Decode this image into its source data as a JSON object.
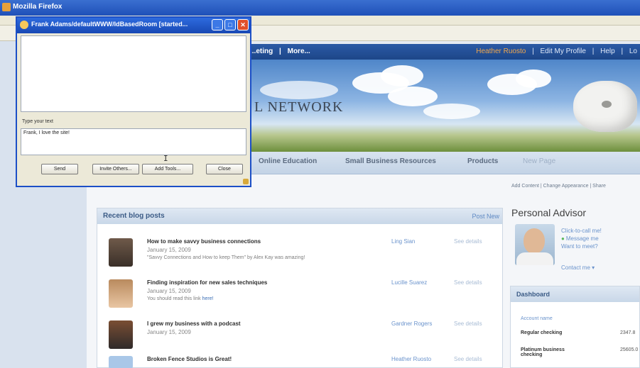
{
  "browser": {
    "title": "Mozilla Firefox"
  },
  "site": {
    "topnav_left": [
      "...eting",
      "|",
      "More..."
    ],
    "topnav_right": [
      "Heather Ruosto",
      "|",
      "Edit My Profile",
      "|",
      "Help",
      "|",
      "Lo"
    ],
    "hero_title": "L NETWORK",
    "tabs": [
      "Online Education",
      "Small Business Resources",
      "Products",
      "New Page"
    ],
    "util_links": "Add Content  |  Change Appearance  |  Share"
  },
  "blog": {
    "title": "Recent blog posts",
    "post_new": "Post New",
    "posts": [
      {
        "title": "How to make savvy business connections",
        "date": "January 15, 2009",
        "excerpt": "\"Savvy Connections and How to keep Them\" by Alex Kay was amazing!",
        "excerpt_link": "",
        "author": "Ling Sian",
        "details": "See details"
      },
      {
        "title": "Finding inspiration for new sales techniques",
        "date": "January 15, 2009",
        "excerpt": "You should read this link",
        "excerpt_link": "here!",
        "author": "Lucille Suarez",
        "details": "See details"
      },
      {
        "title": "I grew my business with a podcast",
        "date": "January 15, 2009",
        "excerpt": "",
        "excerpt_link": "",
        "author": "Gardner Rogers",
        "details": "See details"
      },
      {
        "title": "Broken Fence Studios is Great!",
        "date": "",
        "excerpt": "",
        "excerpt_link": "",
        "author": "Heather Ruosto",
        "details": "See details"
      }
    ]
  },
  "advisor": {
    "title": "Personal Advisor",
    "links": [
      "Click-to-call me!",
      "Message me",
      "Want to meet?"
    ],
    "contact": "Contact me"
  },
  "dashboard": {
    "title": "Dashboard",
    "header_col": "Account name",
    "rows": [
      {
        "name": "Regular checking",
        "value": "2347.8"
      },
      {
        "name": "Platinum business checking",
        "value": "25605.0"
      }
    ]
  },
  "chat": {
    "title": "Frank Adams/defaultWWW/IdBasedRoom [started...",
    "label": "Type your text",
    "input_value": "Frank, I love the site!",
    "buttons": [
      "Send",
      "Invite Others...",
      "Add Tools...",
      "Close"
    ]
  },
  "colors": {
    "accent": "#1c4fc7",
    "nav": "#2b5aa6",
    "link": "#6a93cc"
  }
}
